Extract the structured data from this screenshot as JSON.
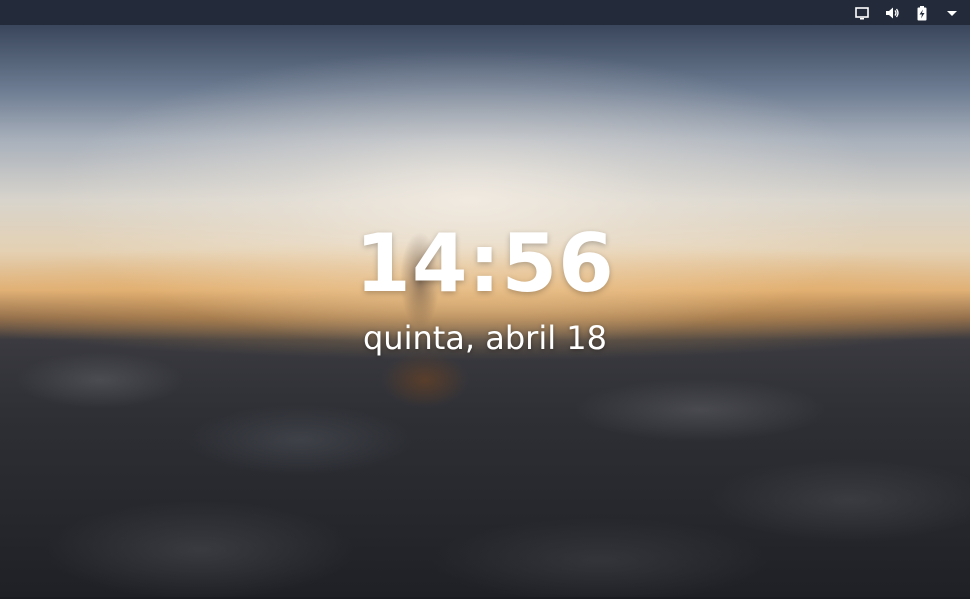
{
  "lock_screen": {
    "time": "14:56",
    "date": "quinta, abril 18"
  },
  "top_panel": {
    "indicators": [
      {
        "icon": "display-icon"
      },
      {
        "icon": "volume-icon"
      },
      {
        "icon": "battery-charging-icon"
      },
      {
        "icon": "menu-arrow-down-icon"
      }
    ]
  },
  "colors": {
    "panel_background": "#232a3a",
    "text": "#ffffff"
  }
}
